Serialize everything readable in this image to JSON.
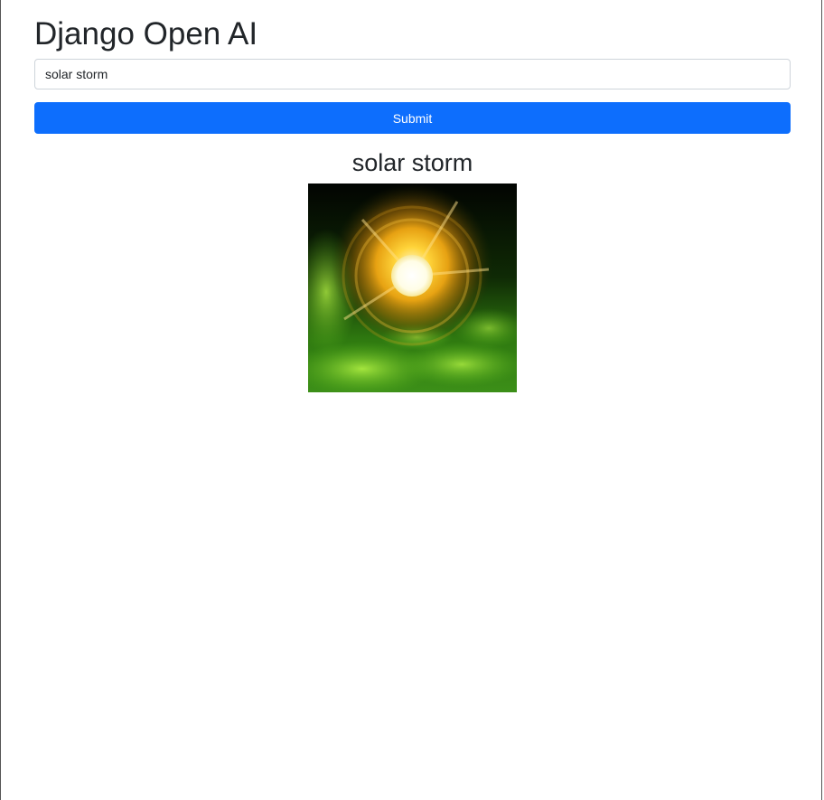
{
  "header": {
    "title": "Django Open AI"
  },
  "form": {
    "prompt_value": "solar storm",
    "submit_label": "Submit"
  },
  "result": {
    "title": "solar storm"
  }
}
